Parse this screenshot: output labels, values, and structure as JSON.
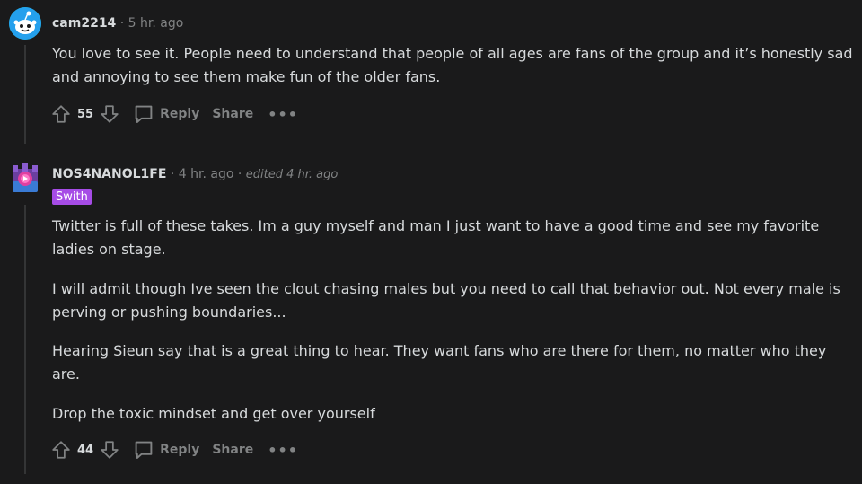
{
  "comments": [
    {
      "username": "cam2214",
      "separator": "·",
      "time": "5 hr. ago",
      "avatar_icon": "snoo-avatar-icon",
      "paragraphs": [
        "You love to see it. People need to understand that people of all ages are fans of the group and it’s honestly sad and annoying to see them make fun of the older fans."
      ],
      "score": "55",
      "reply_label": "Reply",
      "share_label": "Share",
      "more_label": "•••"
    },
    {
      "username": "NOS4NANOL1FE",
      "separator": "·",
      "time": "4 hr. ago",
      "separator2": "·",
      "edited": "edited 4 hr. ago",
      "flair": "Swith",
      "avatar_icon": "castle-avatar-icon",
      "paragraphs": [
        "Twitter is full of these takes. Im a guy myself and man I just want to have a good time and see my favorite ladies on stage.",
        "I will admit though Ive seen the clout chasing males but you need to call that behavior out. Not every male is perving or pushing boundaries...",
        "Hearing Sieun say that is a great thing to hear. They want fans who are there for them, no matter who they are.",
        "Drop the toxic mindset and get over yourself"
      ],
      "score": "44",
      "reply_label": "Reply",
      "share_label": "Share",
      "more_label": "•••"
    }
  ],
  "colors": {
    "background": "#1a1a1b",
    "text": "#d7dadc",
    "muted": "#818384",
    "flair_bg": "#a64ce6",
    "thread_line": "#343536"
  }
}
